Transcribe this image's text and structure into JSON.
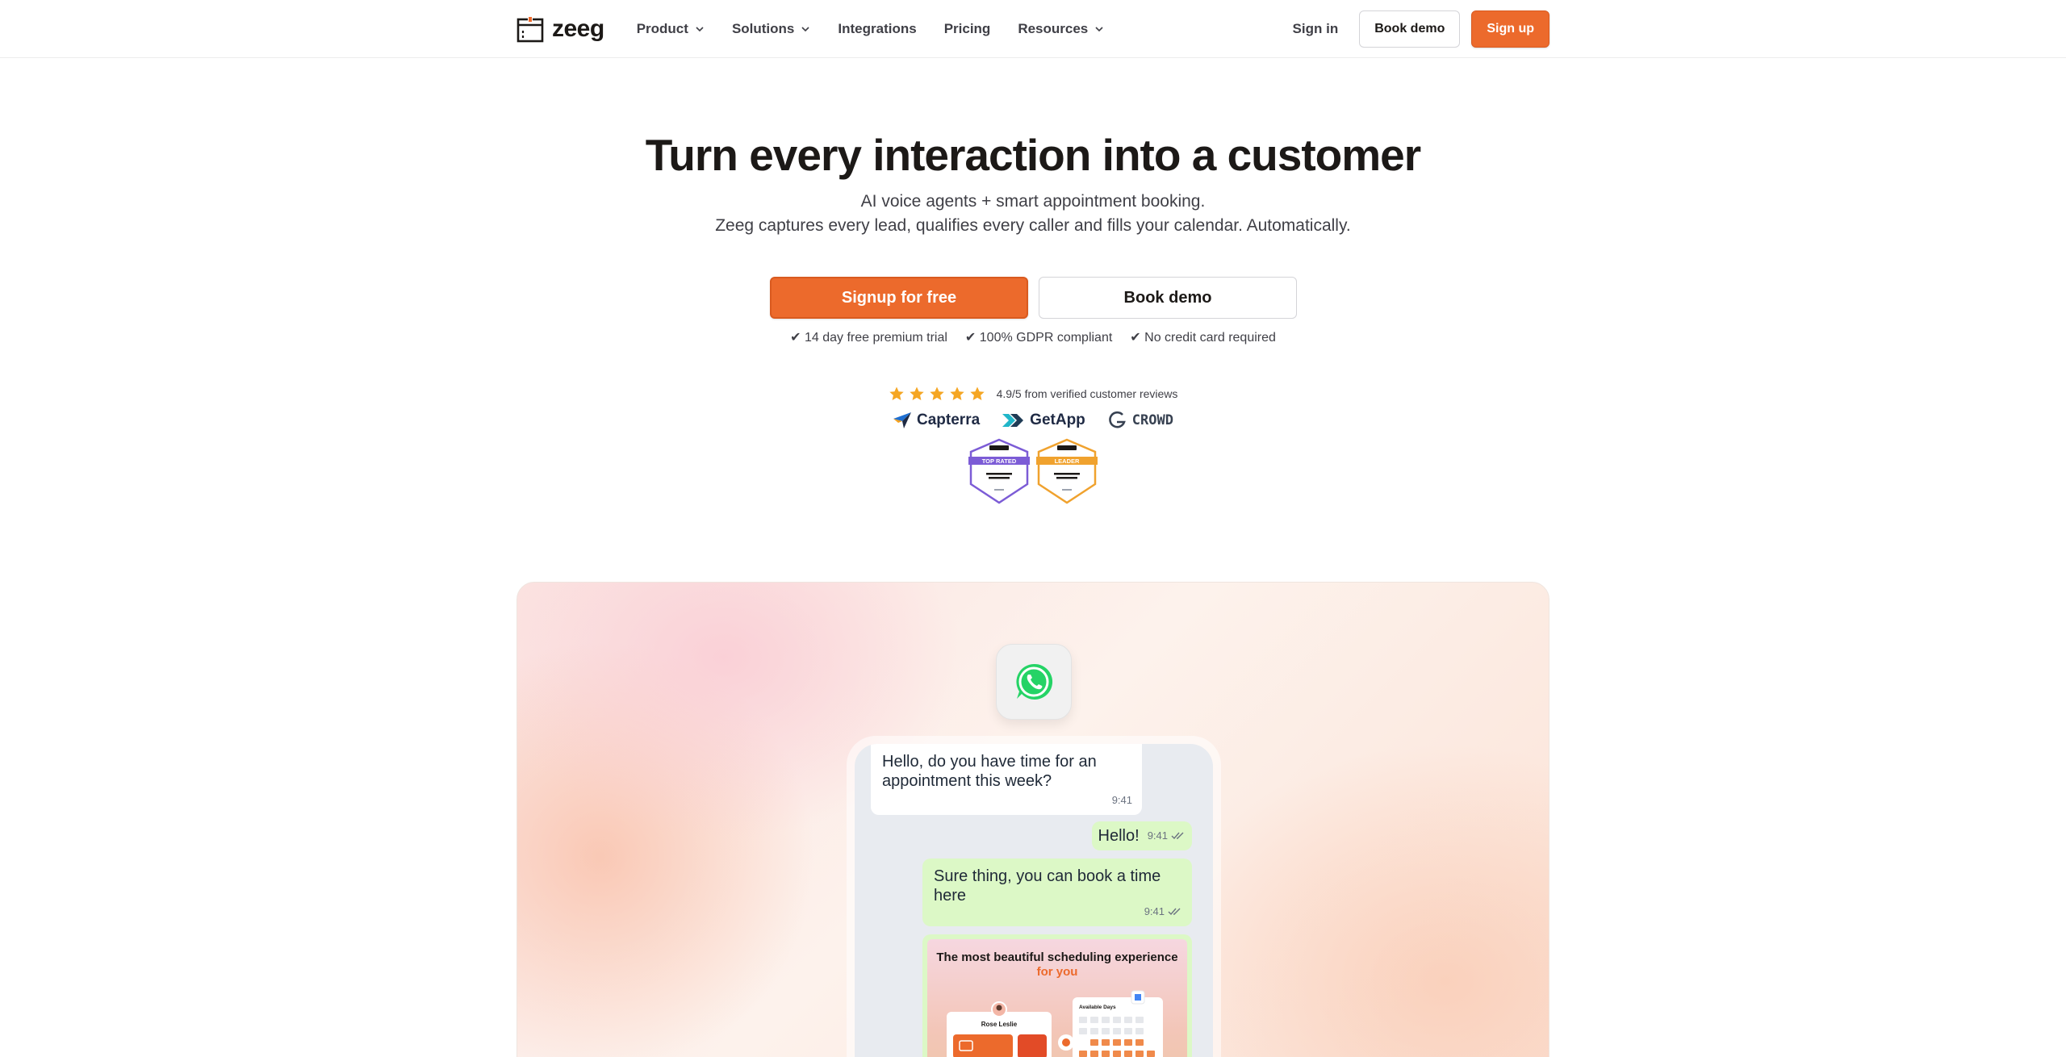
{
  "nav": {
    "brand": "zeeg",
    "items": [
      {
        "label": "Product",
        "dropdown": true
      },
      {
        "label": "Solutions",
        "dropdown": true
      },
      {
        "label": "Integrations",
        "dropdown": false
      },
      {
        "label": "Pricing",
        "dropdown": false
      },
      {
        "label": "Resources",
        "dropdown": true
      }
    ],
    "sign_in": "Sign in",
    "book_demo": "Book demo",
    "sign_up": "Sign up"
  },
  "hero": {
    "title": "Turn every interaction into a customer",
    "subtitle_line1": "AI voice agents + smart appointment booking.",
    "subtitle_line2": "Zeeg captures every lead, qualifies every caller and fills your calendar. Automatically.",
    "cta_primary": "Signup for free",
    "cta_secondary": "Book demo",
    "perks": [
      "✔ 14 day free premium trial",
      "✔ 100% GDPR compliant",
      "✔ No credit card required"
    ]
  },
  "reviews": {
    "stars": 5,
    "rating_text": "4.9/5 from verified customer reviews",
    "platforms": [
      "Capterra",
      "GetApp",
      "CROWD"
    ],
    "badges": [
      {
        "label": "TOP RATED",
        "category": "MEETING MANAGEMENT",
        "color": "#7c5cd6"
      },
      {
        "label": "LEADER",
        "category": "MEETING MANAGEMENT",
        "color": "#f0a22e"
      }
    ]
  },
  "chat": {
    "app": "WhatsApp",
    "messages": [
      {
        "direction": "in",
        "text": "Hello, do you have time for an appointment this week?",
        "time": "9:41"
      },
      {
        "direction": "out",
        "text": "Hello!",
        "time": "9:41"
      },
      {
        "direction": "out",
        "text": "Sure thing, you can book a time here",
        "time": "9:41"
      }
    ],
    "promo_title": "The most beautiful scheduling experience",
    "promo_title_accent": "for you",
    "promo_name": "Rose Leslie",
    "promo_panel": "Available Days"
  },
  "colors": {
    "accent": "#ec6a2c",
    "text": "#1c1917",
    "whatsapp_green": "#25d366",
    "bubble_out": "#dcf8c6"
  }
}
